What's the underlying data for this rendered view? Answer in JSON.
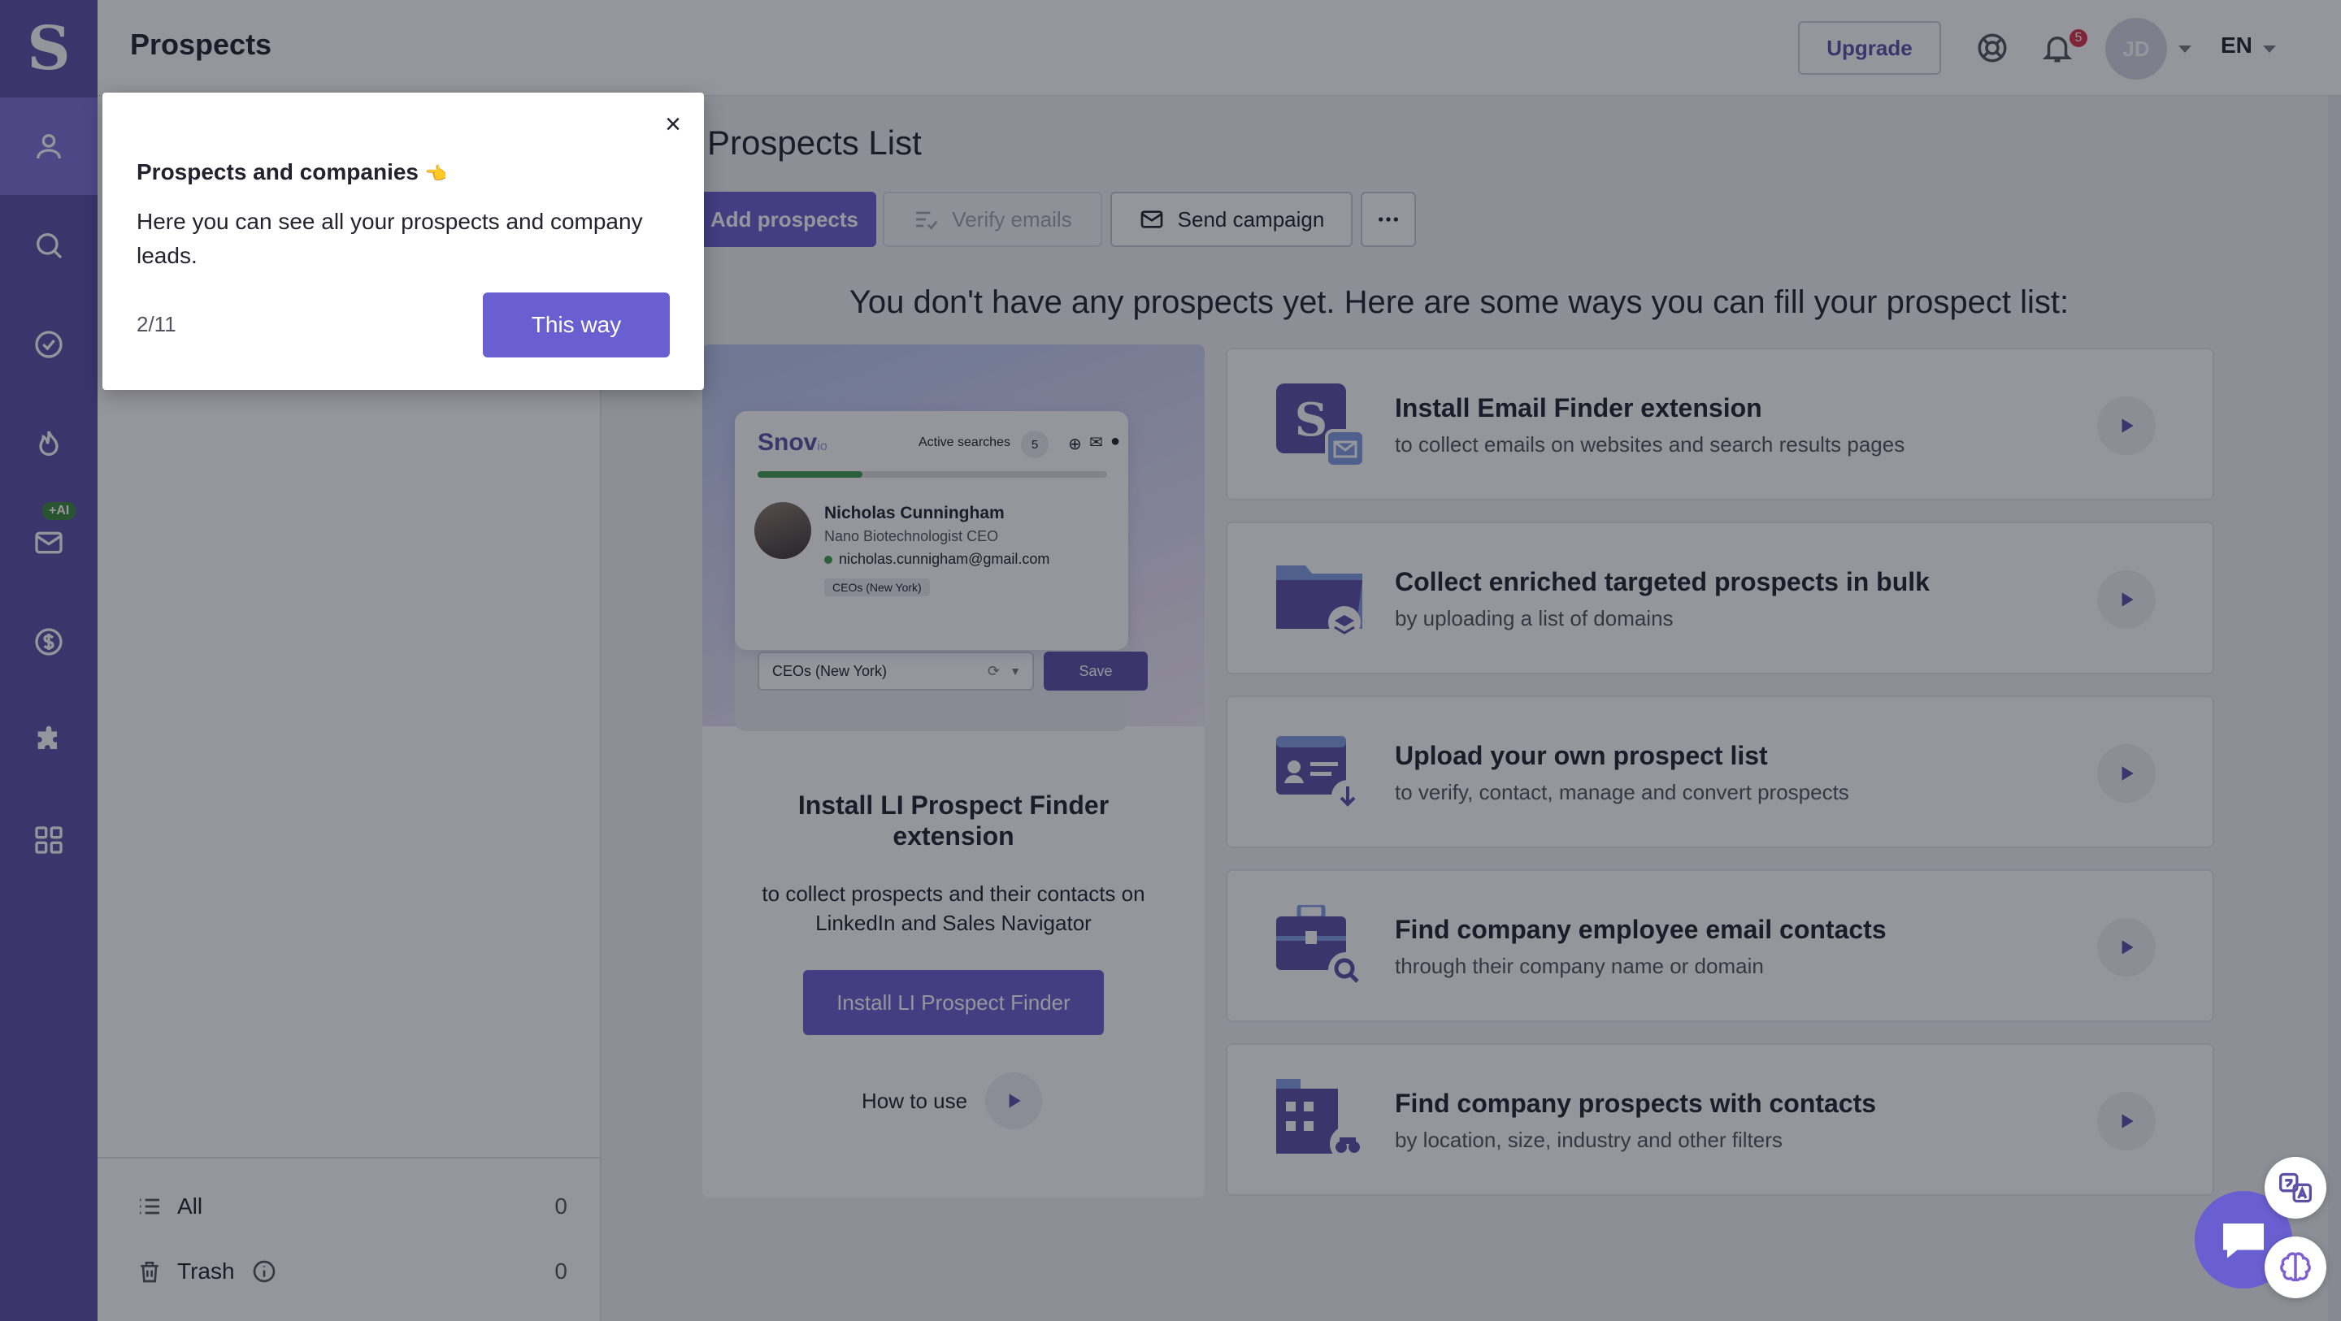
{
  "app": {
    "logo": "S",
    "page_title": "Prospects"
  },
  "sidebar": {
    "ai_badge": "+AI",
    "items": [
      {
        "name": "prospects",
        "icon": "person-icon",
        "active": true
      },
      {
        "name": "search",
        "icon": "search-icon"
      },
      {
        "name": "tasks",
        "icon": "check-circle-icon"
      },
      {
        "name": "warmup",
        "icon": "flame-icon"
      },
      {
        "name": "campaigns",
        "icon": "mail-icon"
      },
      {
        "name": "deals",
        "icon": "dollar-icon"
      },
      {
        "name": "integrations",
        "icon": "puzzle-icon"
      },
      {
        "name": "apps",
        "icon": "grid-icon"
      }
    ]
  },
  "header": {
    "upgrade": "Upgrade",
    "notifications_count": "5",
    "avatar_initials": "JD",
    "language": "EN"
  },
  "left_panel": {
    "lists": [
      {
        "label": "All",
        "count": "0"
      },
      {
        "label": "Trash",
        "count": "0"
      }
    ]
  },
  "main": {
    "title": "Prospects List",
    "actions": {
      "add": "Add prospects",
      "verify": "Verify emails",
      "send": "Send campaign"
    },
    "empty_message": "You don't have any prospects yet. Here are some ways you can fill your prospect list:"
  },
  "li_card": {
    "mock": {
      "brand": "Snov",
      "brand_suffix": "io",
      "active_searches_label": "Active searches",
      "active_searches_count": "5",
      "person_name": "Nicholas Cunningham",
      "person_title": "Nano Biotechnologist CEO",
      "person_email": "nicholas.cunnigham@gmail.com",
      "tag": "CEOs (New York)",
      "select_value": "CEOs (New York)",
      "save": "Save"
    },
    "title": "Install LI Prospect Finder extension",
    "desc": "to collect prospects and their contacts on LinkedIn and Sales Navigator",
    "button": "Install LI Prospect Finder",
    "how_to": "How to use"
  },
  "options": [
    {
      "title": "Install Email Finder extension",
      "sub": "to collect emails on websites and search results pages",
      "icon": "email-finder-extension-icon"
    },
    {
      "title": "Collect enriched targeted prospects in bulk",
      "sub": "by uploading a list of domains",
      "icon": "folder-layers-icon"
    },
    {
      "title": "Upload your own prospect list",
      "sub": "to verify, contact, manage and convert prospects",
      "icon": "upload-list-icon"
    },
    {
      "title": "Find company employee email contacts",
      "sub": "through their company name or domain",
      "icon": "briefcase-search-icon"
    },
    {
      "title": "Find company prospects with contacts",
      "sub": "by location, size, industry and other filters",
      "icon": "building-binoculars-icon"
    }
  ],
  "tooltip": {
    "title": "Prospects and companies",
    "emoji": "👈",
    "text": "Here you can see all your prospects and company leads.",
    "step": "2/11",
    "button": "This way",
    "close": "×"
  },
  "colors": {
    "sidebar": "#5a50a6",
    "accent": "#6a5fd0",
    "sidebar_active": "#7e72d6"
  }
}
